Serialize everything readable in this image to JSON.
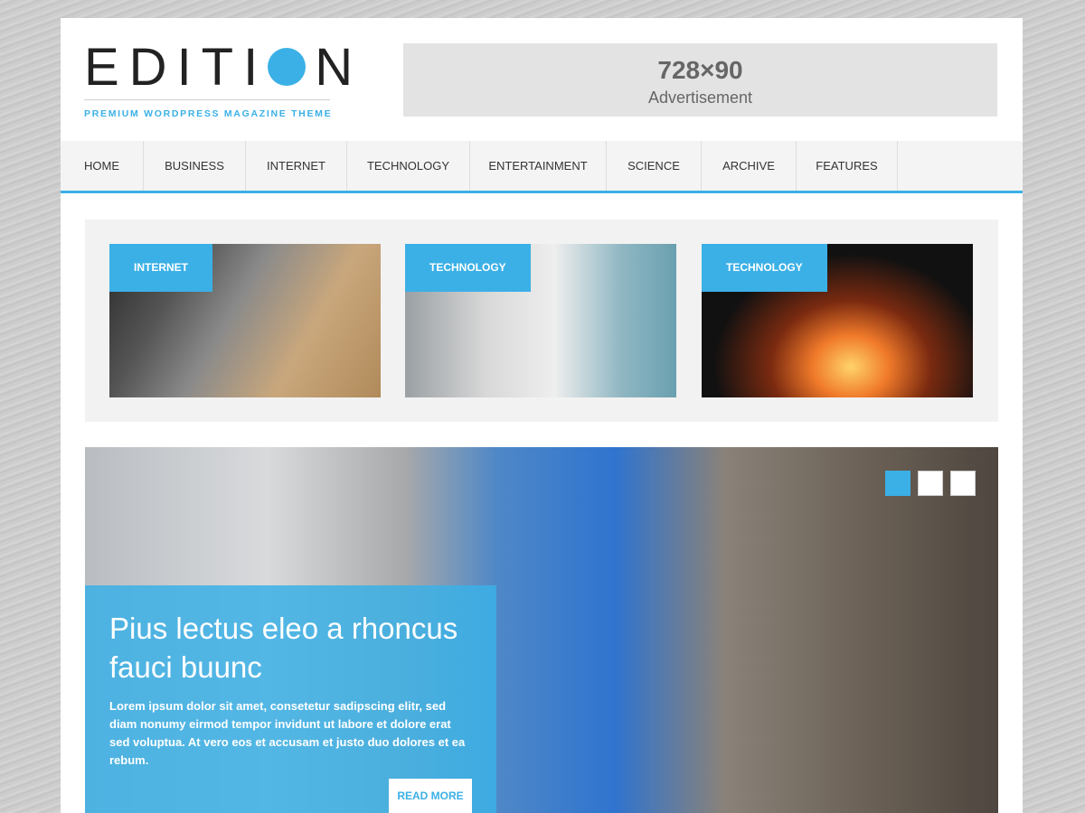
{
  "header": {
    "logo": {
      "letters_before_dot": "EDITI",
      "letters_after_dot": "N",
      "tagline": "PREMIUM WORDPRESS MAGAZINE THEME",
      "accent_color": "#3bb0e6"
    },
    "ad": {
      "size": "728×90",
      "label": "Advertisement"
    }
  },
  "nav": {
    "items": [
      {
        "label": "HOME"
      },
      {
        "label": "BUSINESS"
      },
      {
        "label": "INTERNET"
      },
      {
        "label": "TECHNOLOGY"
      },
      {
        "label": "ENTERTAINMENT"
      },
      {
        "label": "SCIENCE"
      },
      {
        "label": "ARCHIVE"
      },
      {
        "label": "FEATURES"
      }
    ]
  },
  "featured": {
    "cards": [
      {
        "category": "INTERNET"
      },
      {
        "category": "TECHNOLOGY"
      },
      {
        "category": "TECHNOLOGY"
      }
    ]
  },
  "slider": {
    "title": "Pius lectus eleo a rhoncus fauci buunc",
    "text": "Lorem ipsum dolor sit amet, consetetur sadipscing elitr, sed diam nonumy eirmod tempor invidunt ut labore et dolore erat sed voluptua. At vero eos et accusam et justo duo dolores et ea rebum.",
    "button_label": "READ MORE",
    "active_slide": 1,
    "slide_count": 3
  }
}
